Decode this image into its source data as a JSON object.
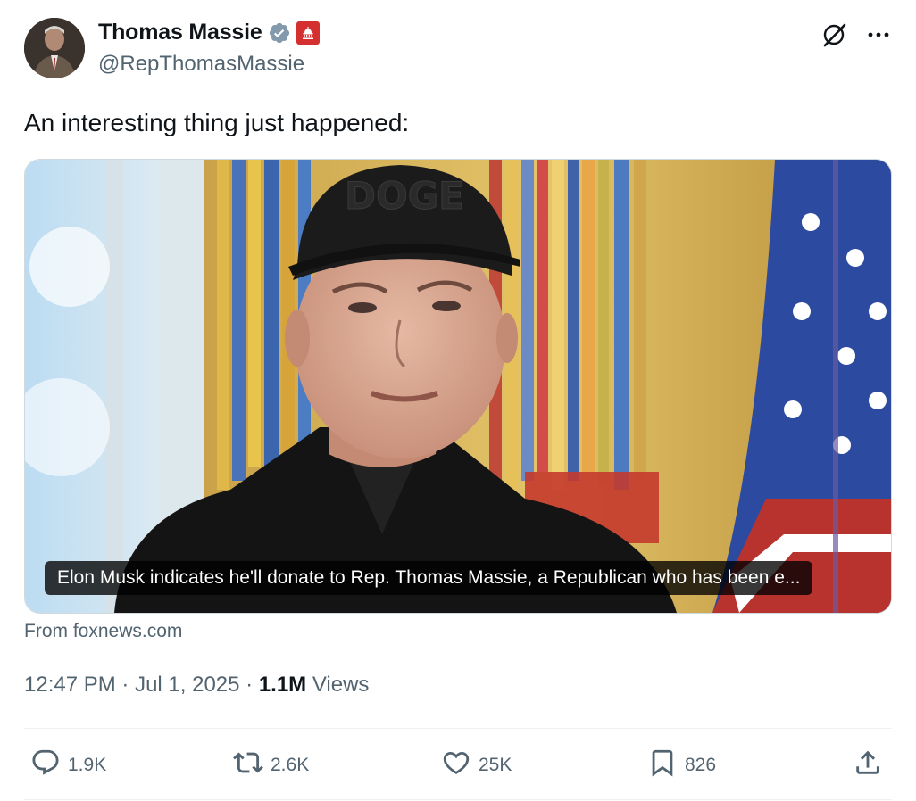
{
  "author": {
    "name": "Thomas Massie",
    "handle": "@RepThomasMassie",
    "verified_icon": "verified-badge-icon",
    "affiliation_icon": "capitol-icon"
  },
  "header_actions": {
    "grok_icon": "grok-icon",
    "more_icon": "more-icon"
  },
  "tweet": {
    "text": "An interesting thing just happened:"
  },
  "card": {
    "caption": "Elon Musk indicates he'll donate to Rep. Thomas Massie, a Republican who has been e...",
    "cap_text": "DOGE",
    "source": "From foxnews.com"
  },
  "meta": {
    "time": "12:47 PM",
    "sep1": " · ",
    "date": "Jul 1, 2025",
    "sep2": " · ",
    "views_count": "1.1M",
    "views_label": " Views"
  },
  "actions": {
    "replies": "1.9K",
    "reposts": "2.6K",
    "likes": "25K",
    "bookmarks": "826"
  },
  "colors": {
    "text": "#0f1419",
    "secondary": "#536471",
    "verified": "#829aab",
    "badge_red": "#d3302f",
    "border": "#cfd9de"
  }
}
